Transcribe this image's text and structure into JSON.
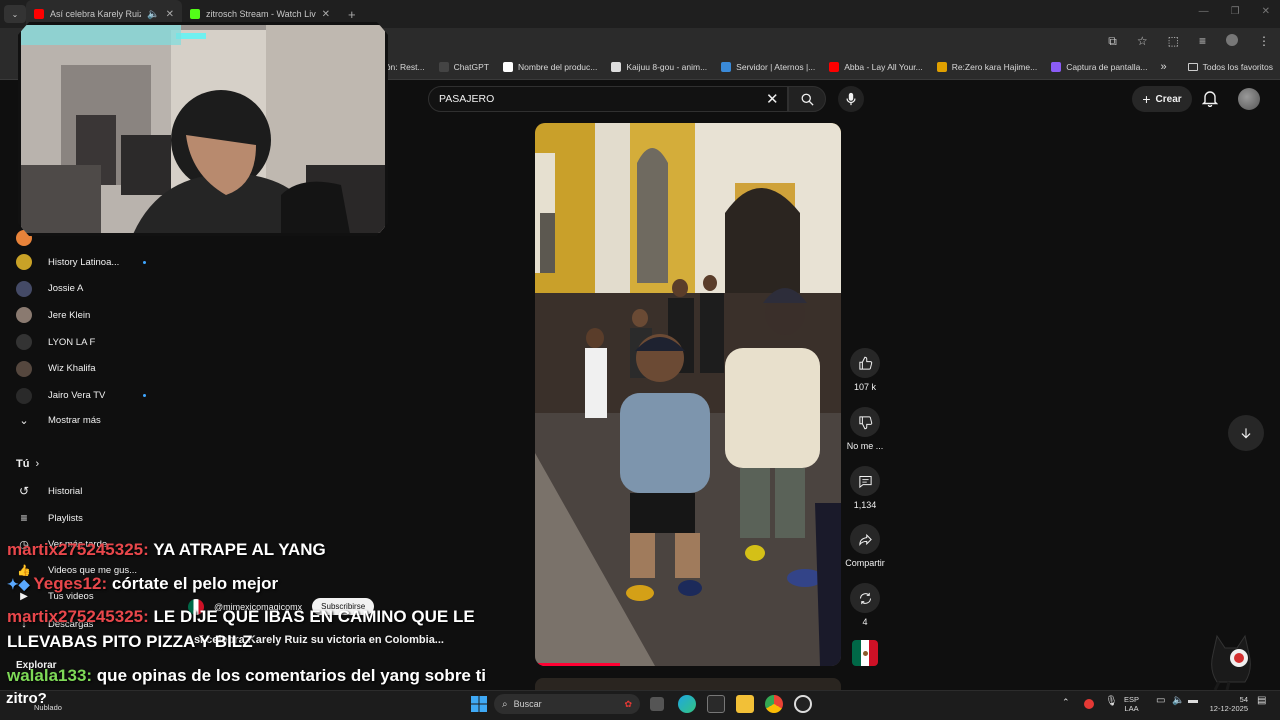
{
  "browser": {
    "tabs": [
      {
        "title": "Así celebra Karely Ruiz su vi",
        "color": "#ff0000"
      },
      {
        "title": "zitrosch Stream - Watch Live on",
        "color": "#53fc18"
      }
    ],
    "new_tab": "+",
    "window_controls": [
      "—",
      "❐",
      "✕"
    ],
    "bookmarks": [
      {
        "label": "ración: Rest...",
        "color": "#666666"
      },
      {
        "label": "ChatGPT",
        "color": "#444444"
      },
      {
        "label": "Nombre del produc...",
        "color": "#ffffff"
      },
      {
        "label": "Kaijuu 8-gou - anim...",
        "color": "#dddddd"
      },
      {
        "label": "Servidor | Aternos |...",
        "color": "#3a8ad8"
      },
      {
        "label": "Abba - Lay All Your...",
        "color": "#ff0000"
      },
      {
        "label": "Re:Zero kara Hajime...",
        "color": "#e0a000"
      },
      {
        "label": "Captura de pantalla...",
        "color": "#8b5cf6"
      }
    ],
    "bookmarks_more": "»",
    "all_favorites": "Todos los favoritos"
  },
  "youtube": {
    "search_value": "PASAJERO",
    "create_label": "Crear",
    "sidebar_subs": [
      {
        "label": "History Latinoa...",
        "dot": true,
        "color": "#c9a227"
      },
      {
        "label": "Jossie A",
        "dot": false,
        "color": "#444a66"
      },
      {
        "label": "Jere Klein",
        "dot": false,
        "color": "#8a7a70"
      },
      {
        "label": "LYON LA F",
        "dot": false,
        "color": "#333333"
      },
      {
        "label": "Wiz Khalifa",
        "dot": false,
        "color": "#55473e"
      },
      {
        "label": "Jairo Vera TV",
        "dot": true,
        "color": "#2a2a2a"
      }
    ],
    "show_more": "Mostrar más",
    "you_header": "Tú",
    "you_items": [
      "Historial",
      "Playlists",
      "Ver más tarde",
      "Videos que me gus...",
      "Tus videos",
      "Descargas"
    ],
    "explore": "Explorar",
    "actions": {
      "likes": "107 k",
      "dislike": "No me ...",
      "comments": "1,134",
      "share": "Compartir",
      "remix": "4"
    },
    "overlay": {
      "channel": "@mimexicomagicomx",
      "subscribe": "Subscribirse",
      "title": "Así celebra Karely Ruiz su victoria en Colombia..."
    },
    "accent": "#ff0033"
  },
  "chat": [
    {
      "user": "martix275245325:",
      "text": "YA ATRAPE AL YANG"
    },
    {
      "user": "Yeges12:",
      "text": "córtate el pelo mejor"
    },
    {
      "user": "martix275245325:",
      "text": "LE DIJE QUE IBAS EN CAMINO QUE LE"
    },
    {
      "user": "",
      "text": "LLEVABAS PITO PIZZA Y BILZ"
    },
    {
      "user": "walala133:",
      "text": "que opinas de los comentarios del yang sobre ti"
    }
  ],
  "stream_brand": "zitro?",
  "taskbar": {
    "weather": "Nublado",
    "search_placeholder": "Buscar",
    "lang_top": "ESP",
    "lang_bottom": "LAA",
    "time": "54",
    "date": "12-12-2025"
  }
}
